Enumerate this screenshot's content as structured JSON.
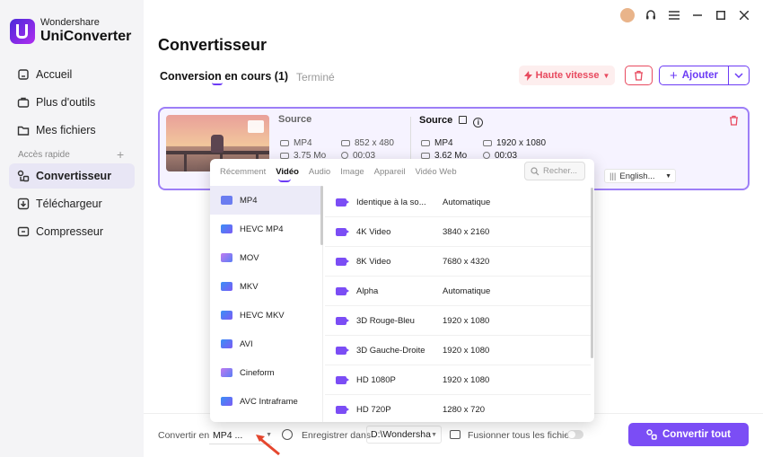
{
  "app": {
    "brand_line1": "Wondershare",
    "brand_line2": "UniConverter"
  },
  "sidebar": {
    "items": [
      {
        "label": "Accueil",
        "icon": "home-icon"
      },
      {
        "label": "Plus d'outils",
        "icon": "toolbox-icon"
      },
      {
        "label": "Mes fichiers",
        "icon": "folder-icon"
      }
    ],
    "section_label": "Accès rapide",
    "quick_items": [
      {
        "label": "Convertisseur",
        "icon": "converter-icon",
        "active": true
      },
      {
        "label": "Téléchargeur",
        "icon": "download-icon"
      },
      {
        "label": "Compresseur",
        "icon": "compress-icon"
      }
    ]
  },
  "header": {
    "title": "Convertisseur"
  },
  "tabs": [
    {
      "label": "Conversion en cours (1)",
      "active": true
    },
    {
      "label": "Terminé"
    }
  ],
  "toolbar": {
    "speed_label": "Haute vitesse",
    "add_label": "Ajouter"
  },
  "file": {
    "source_label": "Source",
    "src_format": "MP4",
    "src_resolution": "852 x 480",
    "src_size": "3.75 Mo",
    "src_duration": "00:03",
    "target_label": "Source",
    "tgt_format": "MP4",
    "tgt_resolution": "1920 x 1080",
    "tgt_size": "3.62 Mo",
    "tgt_duration": "00:03",
    "audio_track": "English..."
  },
  "popup": {
    "tabs": [
      "Récemment",
      "Vidéo",
      "Audio",
      "Image",
      "Appareil",
      "Vidéo Web"
    ],
    "active_tab": "Vidéo",
    "search_placeholder": "Recher...",
    "formats": [
      "MP4",
      "HEVC MP4",
      "MOV",
      "MKV",
      "HEVC MKV",
      "AVI",
      "Cineform",
      "AVC Intraframe"
    ],
    "active_format": "MP4",
    "presets": [
      {
        "name": "Identique à la so...",
        "resolution": "Automatique"
      },
      {
        "name": "4K Video",
        "resolution": "3840 x 2160"
      },
      {
        "name": "8K Video",
        "resolution": "7680 x 4320"
      },
      {
        "name": "Alpha",
        "resolution": "Automatique"
      },
      {
        "name": "3D Rouge-Bleu",
        "resolution": "1920 x 1080"
      },
      {
        "name": "3D Gauche-Droite",
        "resolution": "1920 x 1080"
      },
      {
        "name": "HD 1080P",
        "resolution": "1920 x 1080"
      },
      {
        "name": "HD 720P",
        "resolution": "1280 x 720"
      }
    ]
  },
  "bottom": {
    "convert_to_label": "Convertir en",
    "convert_to_value": "MP4 ...",
    "save_label": "Enregistrer dans",
    "save_path": "D:\\Wondersha",
    "merge_label": "Fusionner tous les fichiers",
    "convert_all_label": "Convertir tout"
  },
  "colors": {
    "accent": "#7b4df5",
    "danger": "#e84a5f"
  }
}
